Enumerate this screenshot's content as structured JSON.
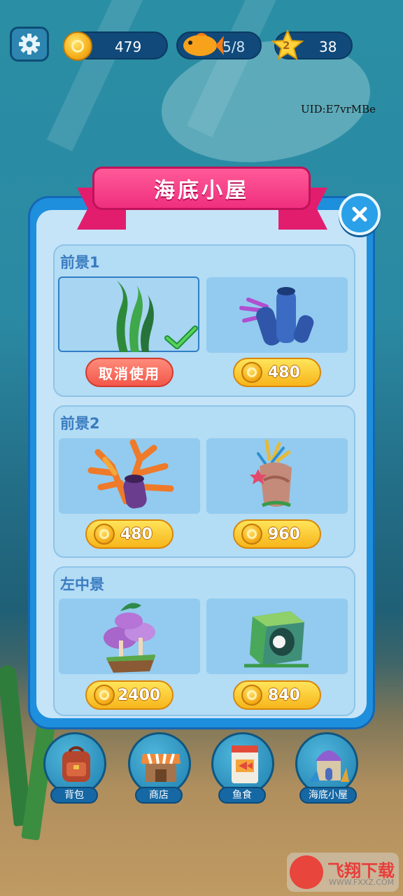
{
  "top_bar": {
    "coins": "479",
    "fish_progress": "5/8",
    "star_level": "2",
    "stars": "38",
    "uid": "UID:E7vrMBe",
    "icons": [
      "gear-icon",
      "gold-coin-icon",
      "goldfish-icon",
      "star-icon"
    ]
  },
  "panel": {
    "title": "海底小屋",
    "close_icon": "close-x-icon",
    "sections": [
      {
        "title": "前景1",
        "items": [
          {
            "name": "green-seaweed",
            "status": "selected",
            "action_label": "取消使用"
          },
          {
            "name": "blue-tube-coral",
            "price": "480"
          }
        ]
      },
      {
        "title": "前景2",
        "items": [
          {
            "name": "orange-coral-with-purple-tube",
            "price": "480"
          },
          {
            "name": "coral-rock-with-starfish",
            "price": "960"
          }
        ]
      },
      {
        "title": "左中景",
        "items": [
          {
            "name": "purple-mushroom-island",
            "price": "2400"
          },
          {
            "name": "green-cube-rock-with-pearl",
            "price": "840"
          }
        ]
      }
    ]
  },
  "bottom_nav": [
    {
      "label": "背包",
      "icon": "backpack-icon"
    },
    {
      "label": "商店",
      "icon": "shop-icon"
    },
    {
      "label": "鱼食",
      "icon": "fish-food-bag-icon"
    },
    {
      "label": "海底小屋",
      "icon": "sea-house-icon"
    }
  ],
  "watermark": {
    "text": "飞翔下载",
    "url": "WWW.FXXZ.COM"
  },
  "colors": {
    "panel_blue": "#1e8fdc",
    "ribbon_pink": "#ef2f7e",
    "coin_gold": "#f6b01c",
    "cancel_red": "#f2584a"
  }
}
